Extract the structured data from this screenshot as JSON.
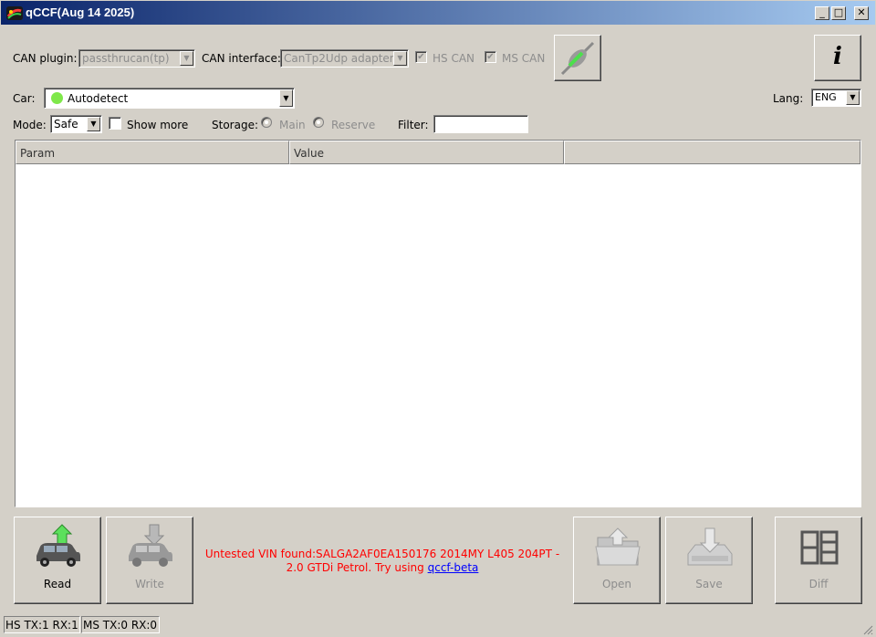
{
  "window": {
    "title": "qCCF(Aug 14 2025)",
    "minimize": "_",
    "maximize": "□",
    "close": "✕"
  },
  "toolbar": {
    "can_plugin_label": "CAN plugin:",
    "can_plugin_value": "passthrucan(tp)",
    "can_interface_label": "CAN interface:",
    "can_interface_value": "CanTp2Udp adapter",
    "hs_can_label": "HS CAN",
    "ms_can_label": "MS CAN",
    "info_label": "i",
    "car_label": "Car:",
    "car_value": "Autodetect",
    "lang_label": "Lang:",
    "lang_value": "ENG",
    "mode_label": "Mode:",
    "mode_value": "Safe",
    "show_more_label": "Show more",
    "storage_label": "Storage:",
    "storage_main": "Main",
    "storage_reserve": "Reserve",
    "filter_label": "Filter:",
    "filter_value": ""
  },
  "table": {
    "columns": [
      "Param",
      "Value",
      ""
    ]
  },
  "actions": {
    "read": "Read",
    "write": "Write",
    "open": "Open",
    "save": "Save",
    "diff": "Diff"
  },
  "message": {
    "text": "Untested VIN found:SALGA2AF0EA150176 2014MY L405 204PT - 2.0 GTDi Petrol. Try using ",
    "link": "qccf-beta"
  },
  "status": {
    "hs": "HS TX:1 RX:1",
    "ms": "MS TX:0 RX:0"
  },
  "colors": {
    "title_start": "#0a246a",
    "title_end": "#a6caf0",
    "message": "#ff0000",
    "link": "#0000ff",
    "car_status": "#7fe84a"
  }
}
